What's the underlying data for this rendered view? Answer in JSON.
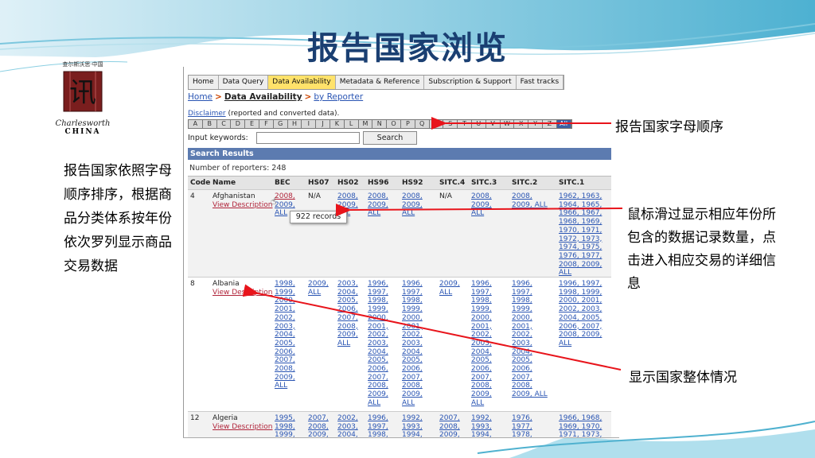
{
  "slide": {
    "title": "报告国家浏览",
    "logo": {
      "caption": "查尔斯沃思·中国",
      "character": "讯",
      "brand": "Charlesworth",
      "cn": "CHINA"
    },
    "left_note": "报告国家依照字母顺序排序，根据商品分类体系按年份依次罗列显示商品交易数据",
    "note_alpha": "报告国家字母顺序",
    "note_mouse": "鼠标滑过显示相应年份所包含的数据记录数量，点击进入相应交易的详细信息",
    "note_country": "显示国家整体情况",
    "colors": {
      "title": "#1a3f72",
      "arrow": "#e8141b",
      "header_bar": "#5c7bb0",
      "active_tab": "#ffe26a"
    }
  },
  "screenshot": {
    "tabs": [
      "Home",
      "Data Query",
      "Data Availability",
      "Metadata & Reference",
      "Subscription & Support",
      "Fast tracks"
    ],
    "active_tab": "Data Availability",
    "breadcrumb": {
      "home": "Home",
      "data_availability": "Data Availability",
      "by_reporter": "by Reporter"
    },
    "disclaimer_link": "Disclaimer",
    "disclaimer_text": "(reported and converted data).",
    "letters": [
      "A",
      "B",
      "C",
      "D",
      "E",
      "F",
      "G",
      "H",
      "I",
      "J",
      "K",
      "L",
      "M",
      "N",
      "O",
      "P",
      "Q",
      "R",
      "S",
      "T",
      "U",
      "V",
      "W",
      "X",
      "Y",
      "Z",
      "All"
    ],
    "keyword_label": "Input keywords:",
    "search_button": "Search",
    "results_header": "Search Results",
    "reporters_count": "Number of reporters: 248",
    "columns": [
      "Code",
      "Name",
      "BEC",
      "HS07",
      "HS02",
      "HS96",
      "HS92",
      "SITC.4",
      "SITC.3",
      "SITC.2",
      "SITC.1"
    ],
    "tooltip": "922 records",
    "rows": [
      {
        "code": "4",
        "name": "Afghanistan",
        "desc": "View Description",
        "BEC": [
          "2008,",
          "2009,",
          "ALL"
        ],
        "HS07": [
          "N/A"
        ],
        "HS02": [
          "2008,",
          "2009,",
          "ALL"
        ],
        "HS96": [
          "2008,",
          "2009,",
          "ALL"
        ],
        "HS92": [
          "2008,",
          "2009,",
          "ALL"
        ],
        "SITC4": [
          "N/A"
        ],
        "SITC3": [
          "2008,",
          "2009,",
          "ALL"
        ],
        "SITC2": [
          "2008,",
          "2009, ALL"
        ],
        "SITC1": [
          "1962, 1963,",
          "1964, 1965,",
          "1966, 1967,",
          "1968, 1969,",
          "1970, 1971,",
          "1972, 1973,",
          "1974, 1975,",
          "1976, 1977,",
          "2008, 2009,",
          "ALL"
        ]
      },
      {
        "code": "8",
        "name": "Albania",
        "desc": "View Description",
        "BEC": [
          "1998,",
          "1999,",
          "2000,",
          "2001,",
          "2002,",
          "2003,",
          "2004,",
          "2005,",
          "2006,",
          "2007,",
          "2008,",
          "2009,",
          "ALL"
        ],
        "HS07": [
          "2009,",
          "ALL"
        ],
        "HS02": [
          "2003,",
          "2004,",
          "2005,",
          "2006,",
          "2007,",
          "2008,",
          "2009,",
          "ALL"
        ],
        "HS96": [
          "1996,",
          "1997,",
          "1998,",
          "1999,",
          "2000,",
          "2001,",
          "2002,",
          "2003,",
          "2004,",
          "2005,",
          "2006,",
          "2007,",
          "2008,",
          "2009,",
          "ALL"
        ],
        "HS92": [
          "1996,",
          "1997,",
          "1998,",
          "1999,",
          "2000,",
          "2001,",
          "2002,",
          "2003,",
          "2004,",
          "2005,",
          "2006,",
          "2007,",
          "2008,",
          "2009,",
          "ALL"
        ],
        "SITC4": [
          "2009,",
          "ALL"
        ],
        "SITC3": [
          "1996,",
          "1997,",
          "1998,",
          "1999,",
          "2000,",
          "2001,",
          "2002,",
          "2003,",
          "2004,",
          "2005,",
          "2006,",
          "2007,",
          "2008,",
          "2009,",
          "ALL"
        ],
        "SITC2": [
          "1996,",
          "1997,",
          "1998,",
          "1999,",
          "2000,",
          "2001,",
          "2002,",
          "2003,",
          "2004,",
          "2005,",
          "2006,",
          "2007,",
          "2008,",
          "2009, ALL"
        ],
        "SITC1": [
          "1996, 1997,",
          "1998, 1999,",
          "2000, 2001,",
          "2002, 2003,",
          "2004, 2005,",
          "2006, 2007,",
          "2008, 2009,",
          "ALL"
        ]
      },
      {
        "code": "12",
        "name": "Algeria",
        "desc": "View Description",
        "BEC": [
          "1995,",
          "1998,",
          "1999,"
        ],
        "HS07": [
          "2007,",
          "2008,",
          "2009,"
        ],
        "HS02": [
          "2002,",
          "2003,",
          "2004,"
        ],
        "HS96": [
          "1996,",
          "1997,",
          "1998,"
        ],
        "HS92": [
          "1992,",
          "1993,",
          "1994,"
        ],
        "SITC4": [
          "2007,",
          "2008,",
          "2009,"
        ],
        "SITC3": [
          "1992,",
          "1993,",
          "1994,"
        ],
        "SITC2": [
          "1976,",
          "1977,",
          "1978,"
        ],
        "SITC1": [
          "1966, 1968,",
          "1969, 1970,",
          "1971, 1973,"
        ]
      }
    ]
  }
}
